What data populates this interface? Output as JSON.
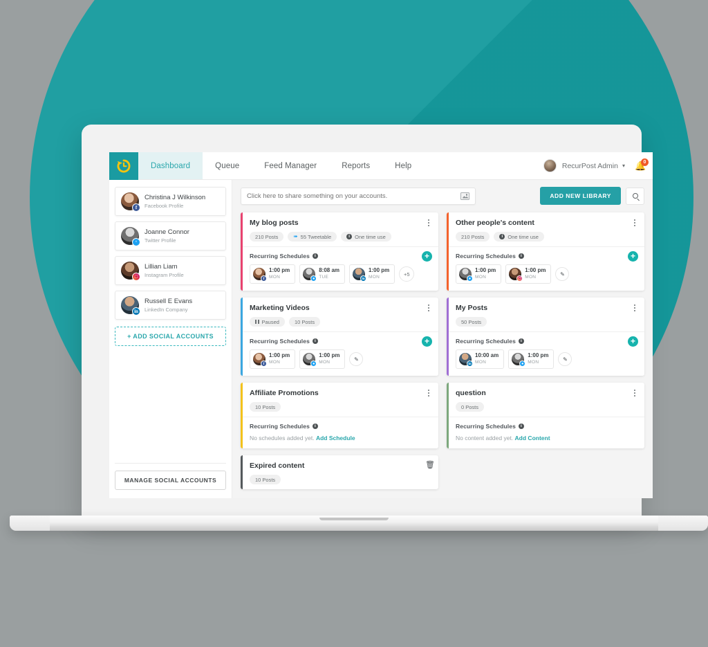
{
  "theme": {
    "accent": "#25a0a6",
    "background": "#9a9fa0",
    "circle": "#169b9e",
    "logo_bg": "#1a9ba1",
    "logo_glyph": "#f6c40e",
    "plus_button": "#16b3ad",
    "link": "#2aa7ac"
  },
  "topnav": {
    "logo_icon": "recurpost-clock-logo",
    "items": [
      {
        "label": "Dashboard",
        "active": true
      },
      {
        "label": "Queue",
        "active": false
      },
      {
        "label": "Feed Manager",
        "active": false
      },
      {
        "label": "Reports",
        "active": false
      },
      {
        "label": "Help",
        "active": false
      }
    ],
    "account": {
      "name": "RecurPost Admin",
      "caret": "▾",
      "avatar_icon": "user-avatar"
    },
    "notifications": {
      "icon": "bell-icon",
      "badge": "0"
    }
  },
  "sidebar": {
    "accounts": [
      {
        "name": "Christina J Wilkinson",
        "type": "Facebook Profile",
        "network": "facebook",
        "glyph": "f"
      },
      {
        "name": "Joanne Connor",
        "type": "Twitter Profile",
        "network": "twitter",
        "glyph": "ᵗ"
      },
      {
        "name": "Lillian Liam",
        "type": "Instagram Profile",
        "network": "instagram",
        "glyph": "□"
      },
      {
        "name": "Russell E Evans",
        "type": "LinkedIn Company",
        "network": "linkedin",
        "glyph": "in"
      }
    ],
    "add_social_label": "+ ADD SOCIAL ACCOUNTS",
    "manage_label": "MANAGE SOCIAL ACCOUNTS"
  },
  "main": {
    "share": {
      "placeholder": "Click here to share something on your accounts.",
      "value": "",
      "image_icon": "image-attachment-icon"
    },
    "add_library_label": "ADD NEW LIBRARY",
    "search_icon": "search-icon",
    "schedules_label": "Recurring Schedules",
    "libraries": [
      {
        "title": "My blog posts",
        "accent": "#e8426f",
        "menu_icon": "kebab-menu-icon",
        "pills": [
          {
            "text": "210 Posts",
            "icon": "none"
          },
          {
            "text": "55 Tweetable",
            "icon": "twitter"
          },
          {
            "text": "One time use",
            "icon": "info"
          }
        ],
        "schedules": [
          {
            "time": "1:00 pm",
            "day": "MON",
            "network": "facebook",
            "glyph": "f",
            "avatar": "av1"
          },
          {
            "time": "8:08 am",
            "day": "TUE",
            "network": "twitter",
            "glyph": "ᵗ",
            "avatar": "av2"
          },
          {
            "time": "1:00 pm",
            "day": "MON",
            "network": "linkedin",
            "glyph": "in",
            "avatar": "av4"
          }
        ],
        "more_label": "+5",
        "has_edit": false,
        "has_add": true,
        "empty_text": "",
        "empty_link": ""
      },
      {
        "title": "Other people's content",
        "accent": "#f4622c",
        "menu_icon": "kebab-menu-icon",
        "pills": [
          {
            "text": "210 Posts",
            "icon": "none"
          },
          {
            "text": "One time use",
            "icon": "info"
          }
        ],
        "schedules": [
          {
            "time": "1:00 pm",
            "day": "MON",
            "network": "twitter",
            "glyph": "ᵗ",
            "avatar": "av2"
          },
          {
            "time": "1:00 pm",
            "day": "MON",
            "network": "instagram",
            "glyph": "□",
            "avatar": "av3"
          }
        ],
        "more_label": "",
        "has_edit": true,
        "has_add": true,
        "empty_text": "",
        "empty_link": ""
      },
      {
        "title": "Marketing Videos",
        "accent": "#3ba7e0",
        "menu_icon": "kebab-menu-icon",
        "pills": [
          {
            "text": "Paused",
            "icon": "pause"
          },
          {
            "text": "10 Posts",
            "icon": "none"
          }
        ],
        "schedules": [
          {
            "time": "1:00 pm",
            "day": "MON",
            "network": "facebook",
            "glyph": "f",
            "avatar": "av1"
          },
          {
            "time": "1:00 pm",
            "day": "MON",
            "network": "twitter",
            "glyph": "ᵗ",
            "avatar": "av2"
          }
        ],
        "more_label": "",
        "has_edit": true,
        "has_add": true,
        "empty_text": "",
        "empty_link": ""
      },
      {
        "title": "My Posts",
        "accent": "#a06fd4",
        "menu_icon": "kebab-menu-icon",
        "pills": [
          {
            "text": "50 Posts",
            "icon": "none"
          }
        ],
        "schedules": [
          {
            "time": "10:00 am",
            "day": "MON",
            "network": "linkedin",
            "glyph": "in",
            "avatar": "av4"
          },
          {
            "time": "1:00 pm",
            "day": "MON",
            "network": "twitter",
            "glyph": "ᵗ",
            "avatar": "av2"
          }
        ],
        "more_label": "",
        "has_edit": true,
        "has_add": true,
        "empty_text": "",
        "empty_link": ""
      },
      {
        "title": "Affiliate Promotions",
        "accent": "#f3c21b",
        "menu_icon": "kebab-menu-icon",
        "pills": [
          {
            "text": "10 Posts",
            "icon": "none"
          }
        ],
        "schedules": [],
        "more_label": "",
        "has_edit": false,
        "has_add": false,
        "empty_text": "No schedules added yet.",
        "empty_link": "Add Schedule"
      },
      {
        "title": "question",
        "accent": "#7da87d",
        "menu_icon": "kebab-menu-icon",
        "pills": [
          {
            "text": "0 Posts",
            "icon": "none"
          }
        ],
        "schedules": [],
        "more_label": "",
        "has_edit": false,
        "has_add": false,
        "empty_text": "No content added yet.",
        "empty_link": "Add Content"
      },
      {
        "title": "Expired content",
        "accent": "#54595c",
        "menu_icon": "trash-icon",
        "pills": [
          {
            "text": "10 Posts",
            "icon": "none"
          }
        ],
        "schedules": [],
        "more_label": "",
        "has_edit": false,
        "has_add": false,
        "empty_text": "",
        "empty_link": "",
        "no_body": true
      }
    ]
  }
}
